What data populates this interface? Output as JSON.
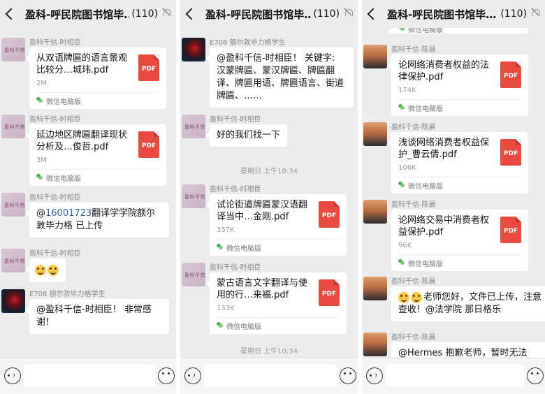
{
  "panels": [
    {
      "header": {
        "title": "盈科-呼民院图书馆毕…",
        "count": "(110)"
      },
      "messages": [
        {
          "sender": "盈科千信-时相臣",
          "file_name": "从双语牌匾的语言景观比较分…城玮.pdf",
          "file_size": "2M",
          "file_source": "微信电脑版"
        },
        {
          "sender": "盈科千信-时相臣",
          "file_name": "延边地区牌匾翻译现状分析及…俊哲.pdf",
          "file_size": "3M",
          "file_source": "微信电脑版"
        },
        {
          "sender": "盈科千信-时相臣",
          "text_prefix": "@",
          "text_link": "16001723",
          "text_rest": "翻译学学院额尔敦毕力格 已上传"
        },
        {
          "sender": "盈科千信-时相臣",
          "text": ""
        },
        {
          "sender": "E708 额尔敦毕力格学生",
          "text": "@盈科千信-时相臣！ 非常感谢!"
        }
      ]
    },
    {
      "header": {
        "title": "盈科-呼民院图书馆毕…",
        "count": "(110)"
      },
      "messages": [
        {
          "sender": "E708 额尔敦毕力格学生",
          "text": "@盈科千信-时相臣！ 关键字: 汉蒙牌匾、蒙汉牌匾、牌匾翻译、牌匾用语、牌匾语言、街道牌匾、……"
        },
        {
          "sender": "盈科千信-时相臣",
          "text": "好的我们找一下"
        },
        {
          "timestamp": "星期日 上午10:34"
        },
        {
          "sender": "盈科千信-时相臣",
          "file_name": "试论街道牌匾蒙汉语翻译当中…金刚.pdf",
          "file_size": "357K",
          "file_source": "微信电脑版"
        },
        {
          "sender": "盈科千信-时相臣",
          "file_name": "蒙古语言文字翻译与使用的行…来福.pdf",
          "file_size": "133K",
          "file_source": "微信电脑版"
        },
        {
          "timestamp": "星期日 上午10:34"
        }
      ]
    },
    {
      "header": {
        "title": "盈科-呼民院图书馆毕…",
        "count": "(110)"
      },
      "messages": [
        {
          "file_source": "微信电脑版"
        },
        {
          "sender": "盈科千信-陈晨",
          "file_name": "论网络消费者权益的法律保护.pdf",
          "file_size": "174K",
          "file_source": "微信电脑版"
        },
        {
          "sender": "盈科千信-陈晨",
          "file_name": "浅谈网络消费者权益保护_曹云倩.pdf",
          "file_size": "106K",
          "file_source": "微信电脑版"
        },
        {
          "sender": "盈科千信-陈晨",
          "file_name": "论网络交易中消费者权益保护.pdf",
          "file_size": "96K",
          "file_source": "微信电脑版"
        },
        {
          "sender": "盈科千信-陈晨",
          "text": "老师您好，文件已上传，注意查收！@法学院 那日格乐"
        },
        {
          "sender": "盈科千信-陈晨",
          "text": "@Hermes 抱歉老师，暂时无法"
        }
      ]
    }
  ],
  "common": {
    "pdf_label": "PDF",
    "avatar_brand": "盈科千信"
  },
  "colors": {
    "background": "#ececec",
    "bubble": "#ffffff",
    "pdf": "#e94a3f",
    "link": "#2b63b8"
  },
  "icons": [
    "back-arrow-icon",
    "mute-bell-icon",
    "pdf-file-icon",
    "wechat-pc-icon",
    "voice-icon",
    "emoji-icon"
  ]
}
